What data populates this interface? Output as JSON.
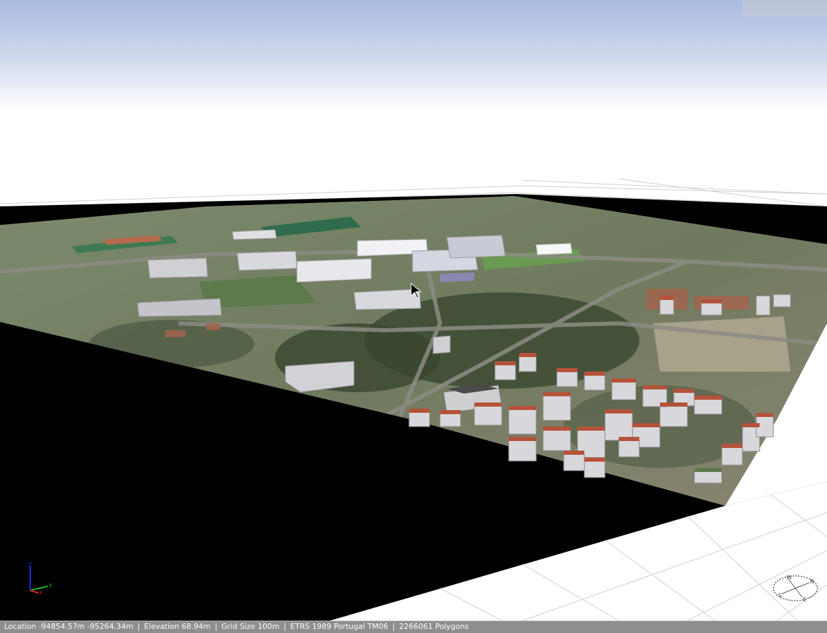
{
  "scene": {
    "sky_top_color": "#a9b9e0",
    "sky_horizon_color": "#ffffff",
    "ground_grid_color": "#c8c8c8",
    "terrain_base_color": "#000000",
    "roof_color": "#b5523a",
    "wall_color": "#d8d8dc"
  },
  "gizmo": {
    "z_label": "Z",
    "y_label": "Y",
    "x_label": "X"
  },
  "compass": {
    "icon": "compass-rose-icon",
    "n": "N",
    "s": "S",
    "e": "E",
    "w": "W"
  },
  "status": {
    "location": "Location -94854.57m -95264.34m",
    "elevation": "Elevation 68.94m",
    "grid_size": "Grid Size 100m",
    "crs": "ETRS 1989 Portugal TM06",
    "polygons": "2266061 Polygons"
  }
}
